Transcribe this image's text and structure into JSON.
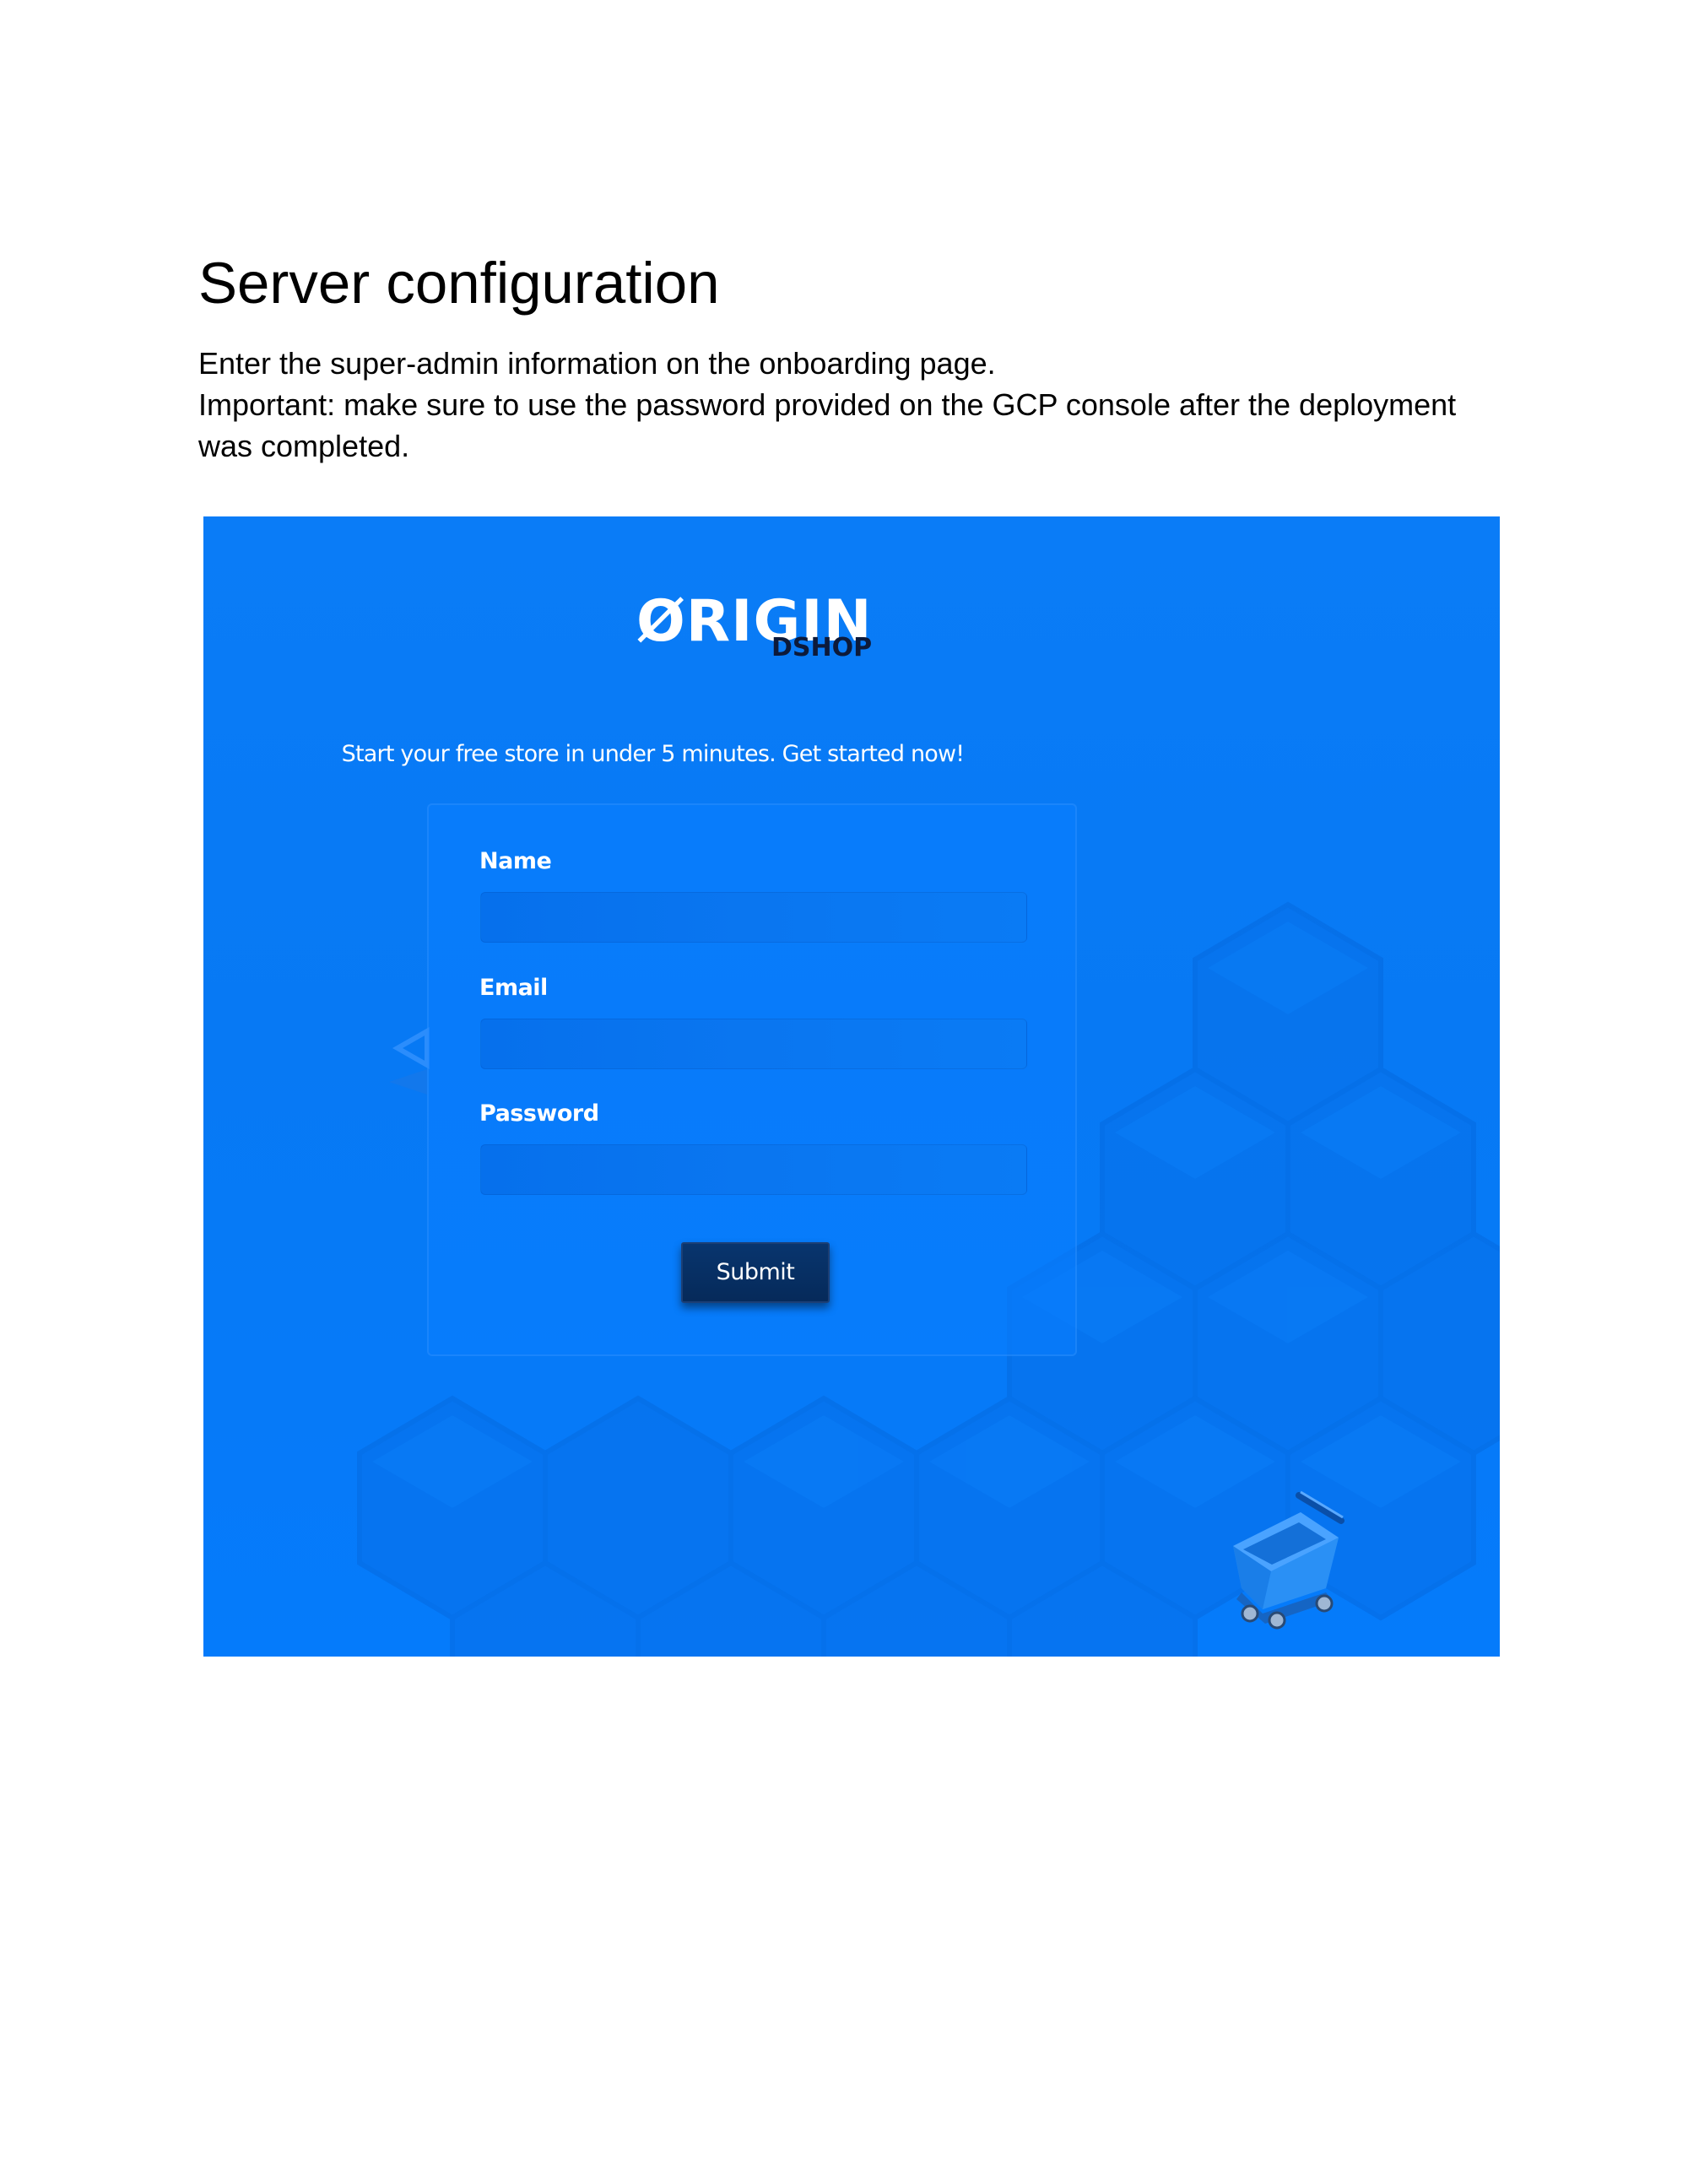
{
  "document": {
    "title": "Server configuration",
    "paragraph": {
      "line1": "Enter the super-admin information on the onboarding page.",
      "line2": "Important: make sure to use the password provided on the GCP console after the deployment was completed."
    }
  },
  "screenshot": {
    "logo": {
      "wordmark": "ØRIGIN",
      "sub": "DSHOP"
    },
    "tagline": "Start your free store in under 5 minutes. Get started now!",
    "form": {
      "name_label": "Name",
      "name_value": "",
      "email_label": "Email",
      "email_value": "",
      "password_label": "Password",
      "password_value": "",
      "submit_label": "Submit"
    },
    "colors": {
      "background": "#0779f4",
      "button": "#062a5a",
      "text": "#ffffff"
    },
    "icons": [
      "shopping-cart-icon",
      "hexagon-cube-pattern"
    ]
  }
}
